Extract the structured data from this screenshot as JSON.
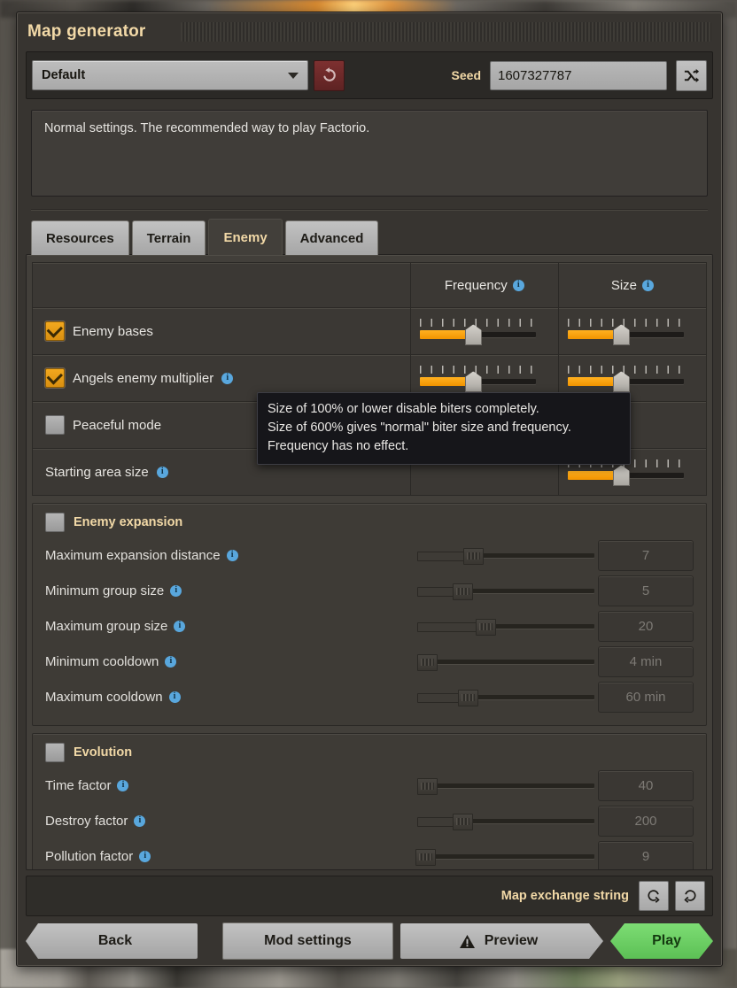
{
  "window": {
    "title": "Map generator"
  },
  "toolbar": {
    "preset": "Default",
    "preset_caret": "chevron-down-icon",
    "reset_icon": "reset-icon",
    "seed_label": "Seed",
    "seed_value": "1607327787",
    "shuffle_icon": "shuffle-icon"
  },
  "description": "Normal settings. The recommended way to play Factorio.",
  "tabs": [
    {
      "label": "Resources",
      "active": false
    },
    {
      "label": "Terrain",
      "active": false
    },
    {
      "label": "Enemy",
      "active": true
    },
    {
      "label": "Advanced",
      "active": false
    }
  ],
  "table": {
    "headers": {
      "name": "",
      "frequency": "Frequency",
      "size": "Size",
      "info_icon": "info-icon"
    },
    "rows": [
      {
        "label": "Enemy bases",
        "checked": true,
        "has_info": false,
        "frequency_pct": 45,
        "size_pct": 45
      },
      {
        "label": "Angels enemy multiplier",
        "checked": true,
        "has_info": true,
        "frequency_pct": 45,
        "size_pct": 45
      }
    ],
    "peaceful": {
      "label": "Peaceful mode",
      "checked": false
    },
    "starting_area": {
      "label": "Starting area size",
      "has_info": true,
      "size_pct": 45
    }
  },
  "tooltip": {
    "lines": [
      "Size of 100% or lower disable biters completely.",
      "Size of 600% gives \"normal\" biter size and frequency.",
      "Frequency has no effect."
    ]
  },
  "enemy_expansion": {
    "title": "Enemy expansion",
    "checked": false,
    "options": [
      {
        "label": "Maximum expansion distance",
        "value": "7",
        "pct": 31
      },
      {
        "label": "Minimum group size",
        "value": "5",
        "pct": 25
      },
      {
        "label": "Maximum group size",
        "value": "20",
        "pct": 38
      },
      {
        "label": "Minimum cooldown",
        "value": "4 min",
        "pct": 5
      },
      {
        "label": "Maximum cooldown",
        "value": "60 min",
        "pct": 28
      }
    ]
  },
  "evolution": {
    "title": "Evolution",
    "checked": false,
    "options": [
      {
        "label": "Time factor",
        "value": "40",
        "pct": 5
      },
      {
        "label": "Destroy factor",
        "value": "200",
        "pct": 25
      },
      {
        "label": "Pollution factor",
        "value": "9",
        "pct": 4
      }
    ]
  },
  "exchange": {
    "label": "Map exchange string",
    "import_icon": "import-arrow-icon",
    "export_icon": "export-arrow-icon"
  },
  "footer_buttons": {
    "back": "Back",
    "mod_settings": "Mod settings",
    "preview": "Preview",
    "preview_icon": "warning-triangle-icon",
    "play": "Play"
  },
  "colors": {
    "accent_orange": "#f2a81e",
    "title_text": "#f2d9a7",
    "play_green": "#5cc055",
    "info_blue": "#59a7dd",
    "panel_bg": "#423f3a"
  }
}
